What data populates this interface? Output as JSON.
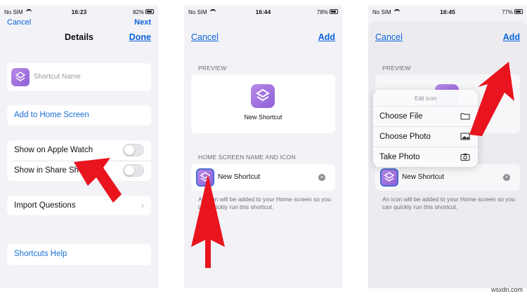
{
  "screens": [
    {
      "status": {
        "carrier": "No SIM",
        "time": "16:23",
        "battery": "82%"
      },
      "nav": {
        "left": "Cancel",
        "title": "Details",
        "right": "Done",
        "right_top": "Next"
      },
      "shortcut_name_placeholder": "Shortcut Name",
      "add_home": "Add to Home Screen",
      "toggles": [
        "Show on Apple Watch",
        "Show in Share Sheet"
      ],
      "import_questions": "Import Questions",
      "help": "Shortcuts Help"
    },
    {
      "status": {
        "carrier": "No SIM",
        "time": "16:44",
        "battery": "78%"
      },
      "nav": {
        "left": "Cancel",
        "right": "Add"
      },
      "preview_label": "PREVIEW",
      "preview_name": "New Shortcut",
      "section_label": "HOME SCREEN NAME AND ICON",
      "name_value": "New Shortcut",
      "note": "An icon will be added to your Home screen so you can quickly run this shortcut."
    },
    {
      "status": {
        "carrier": "No SIM",
        "time": "16:45",
        "battery": "77%"
      },
      "nav": {
        "left": "Cancel",
        "right": "Add"
      },
      "preview_label": "PREVIEW",
      "menu_title": "Edit Icon",
      "menu_items": [
        {
          "label": "Choose File",
          "icon": "folder-icon"
        },
        {
          "label": "Choose Photo",
          "icon": "photos-icon"
        },
        {
          "label": "Take Photo",
          "icon": "camera-icon"
        }
      ],
      "name_value": "New Shortcut",
      "note": "An icon will be added to your Home screen so you can quickly run this shortcut."
    }
  ],
  "watermark": "wsxdn.com",
  "colors": {
    "accent": "#0a63d8",
    "background": "#f2f2f7",
    "icon": "#9b6ade",
    "arrow": "#e8141e"
  }
}
